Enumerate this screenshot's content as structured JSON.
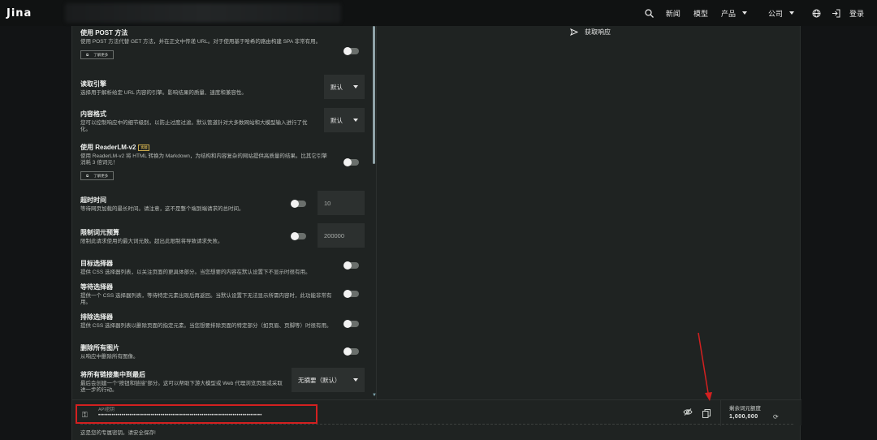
{
  "header": {
    "logo": "Jina",
    "nav": {
      "news": "新闻",
      "models": "模型",
      "products": "产品",
      "company": "公司",
      "login": "登录"
    }
  },
  "response": {
    "label": "获取响应"
  },
  "options": [
    {
      "title": "使用 POST 方法",
      "desc": "使用 POST 方法代替 GET 方法，并在正文中传递 URL。对于使用基于哈希的路由构建 SPA 非常有用。",
      "learn_more": "了解更多"
    },
    {
      "title": "读取引擎",
      "desc": "选择用于解析给定 URL 内容的引擎。影响结果的质量、速度和兼容性。",
      "select": "默认"
    },
    {
      "title": "内容格式",
      "desc": "您可以控制响应中的细节级别，以防止过度过滤。默认管道针对大多数网站和大模型输入进行了优化。",
      "select": "默认"
    },
    {
      "title": "使用 ReaderLM-v2",
      "badge": "实验",
      "desc": "使用 ReaderLM-v2 将 HTML 转换为 Markdown，为结构和内容复杂的网站提供高质量的结果。比其它引擎消耗 3 倍词元！",
      "learn_more": "了解更多"
    },
    {
      "title": "超时时间",
      "desc": "等待网页加载的最长时间。请注意，这不是整个端到端请求的总时间。",
      "input": "10"
    },
    {
      "title": "限制词元预算",
      "desc": "限制此请求使用的最大词元数。超出此限制将导致请求失败。",
      "input": "200000"
    },
    {
      "title": "目标选择器",
      "desc": "提供 CSS 选择器列表，以关注页面的更具体部分。当您想要的内容在默认设置下不显示时很有用。"
    },
    {
      "title": "等待选择器",
      "desc": "提供一个 CSS 选择器列表，等待特定元素出现后再返回。当默认设置下无法显示所需内容时，此功能非常有用。"
    },
    {
      "title": "排除选择器",
      "desc": "提供 CSS 选择器列表以删除页面的指定元素。当您想要排除页面的特定部分（如页眉、页脚等）时很有用。"
    },
    {
      "title": "删除所有图片",
      "desc": "从响应中删除所有图像。"
    },
    {
      "title": "将所有链接集中到最后",
      "desc": "最后会创建一个“按钮和链接”部分。这可以帮助下游大模型或 Web 代理浏览页面或采取进一步的行动。",
      "select": "无摘要（默认）"
    }
  ],
  "api_key": {
    "label": "API密钥",
    "value": "••••••••••••••••••••••••••••••••••••••••••••••••••••••••••••••••••••••••••••••••••••"
  },
  "quota": {
    "label": "剩余词元额度",
    "value": "1,000,000"
  },
  "hint": "这是您的专属密钥。请安全保存!",
  "colors": {
    "annotation": "#d32020",
    "background": "#1f2322"
  }
}
